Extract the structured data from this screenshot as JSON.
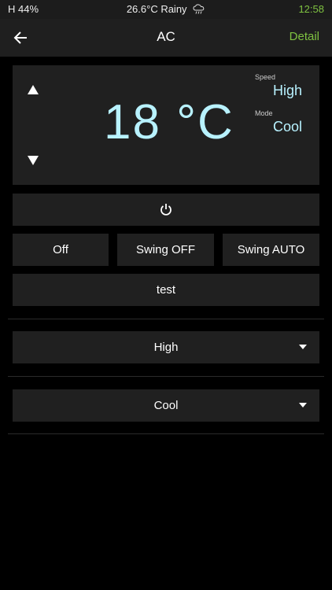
{
  "status_bar": {
    "humidity": "H 44%",
    "weather": "26.6°C  Rainy",
    "weather_icon": "rain-cloud-icon",
    "time": "12:58"
  },
  "app_bar": {
    "title": "AC",
    "detail": "Detail",
    "back_icon": "arrow-left-icon"
  },
  "panel": {
    "temperature": "18 °C",
    "speed_label": "Speed",
    "speed_value": "High",
    "mode_label": "Mode",
    "mode_value": "Cool"
  },
  "buttons": {
    "power_icon": "power-icon",
    "off": "Off",
    "swing_off": "Swing OFF",
    "swing_auto": "Swing AUTO",
    "test": "test"
  },
  "selects": {
    "speed": "High",
    "mode": "Cool"
  },
  "colors": {
    "accent_green": "#7fc241",
    "readout_cyan": "#b8f2ff",
    "tile": "#202020",
    "background": "#000000"
  }
}
